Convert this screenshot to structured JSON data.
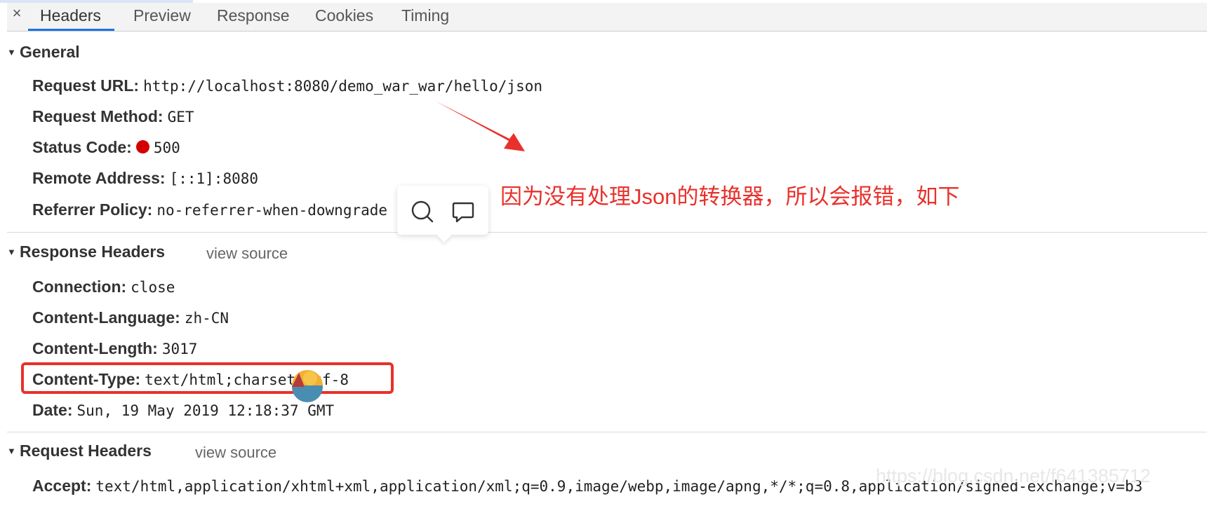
{
  "tabs": {
    "close_label": "×",
    "items": [
      "Headers",
      "Preview",
      "Response",
      "Cookies",
      "Timing"
    ],
    "active": "Headers"
  },
  "general": {
    "title": "General",
    "rows": [
      {
        "key": "Request URL:",
        "value": "http://localhost:8080/demo_war_war/hello/json"
      },
      {
        "key": "Request Method:",
        "value": "GET"
      },
      {
        "key": "Status Code:",
        "value": "500"
      },
      {
        "key": "Remote Address:",
        "value": "[::1]:8080"
      },
      {
        "key": "Referrer Policy:",
        "value": "no-referrer-when-downgrade"
      }
    ]
  },
  "response_headers": {
    "title": "Response Headers",
    "view_source": "view source",
    "rows": [
      {
        "key": "Connection:",
        "value": "close"
      },
      {
        "key": "Content-Language:",
        "value": "zh-CN"
      },
      {
        "key": "Content-Length:",
        "value": "3017"
      },
      {
        "key": "Content-Type:",
        "value": "text/html;charset=utf-8"
      },
      {
        "key": "Date:",
        "value": "Sun, 19 May 2019 12:18:37 GMT"
      }
    ]
  },
  "request_headers": {
    "title": "Request Headers",
    "view_source": "view source",
    "rows": [
      {
        "key": "Accept:",
        "value": "text/html,application/xhtml+xml,application/xml;q=0.9,image/webp,image/apng,*/*;q=0.8,application/signed-exchange;v=b3"
      }
    ]
  },
  "annotation": "因为没有处理Json的转换器，所以会报错，如下",
  "watermark": "https://blog.csdn.net/f641385712",
  "colors": {
    "annotation_red": "#e8312b",
    "status_error": "#d40000",
    "tab_active_underline": "#1a73e8"
  },
  "icons": {
    "popover": [
      "search-icon",
      "comment-icon"
    ],
    "overlay": "assistant-avatar-icon",
    "annotation_arrow": "red-arrow"
  }
}
